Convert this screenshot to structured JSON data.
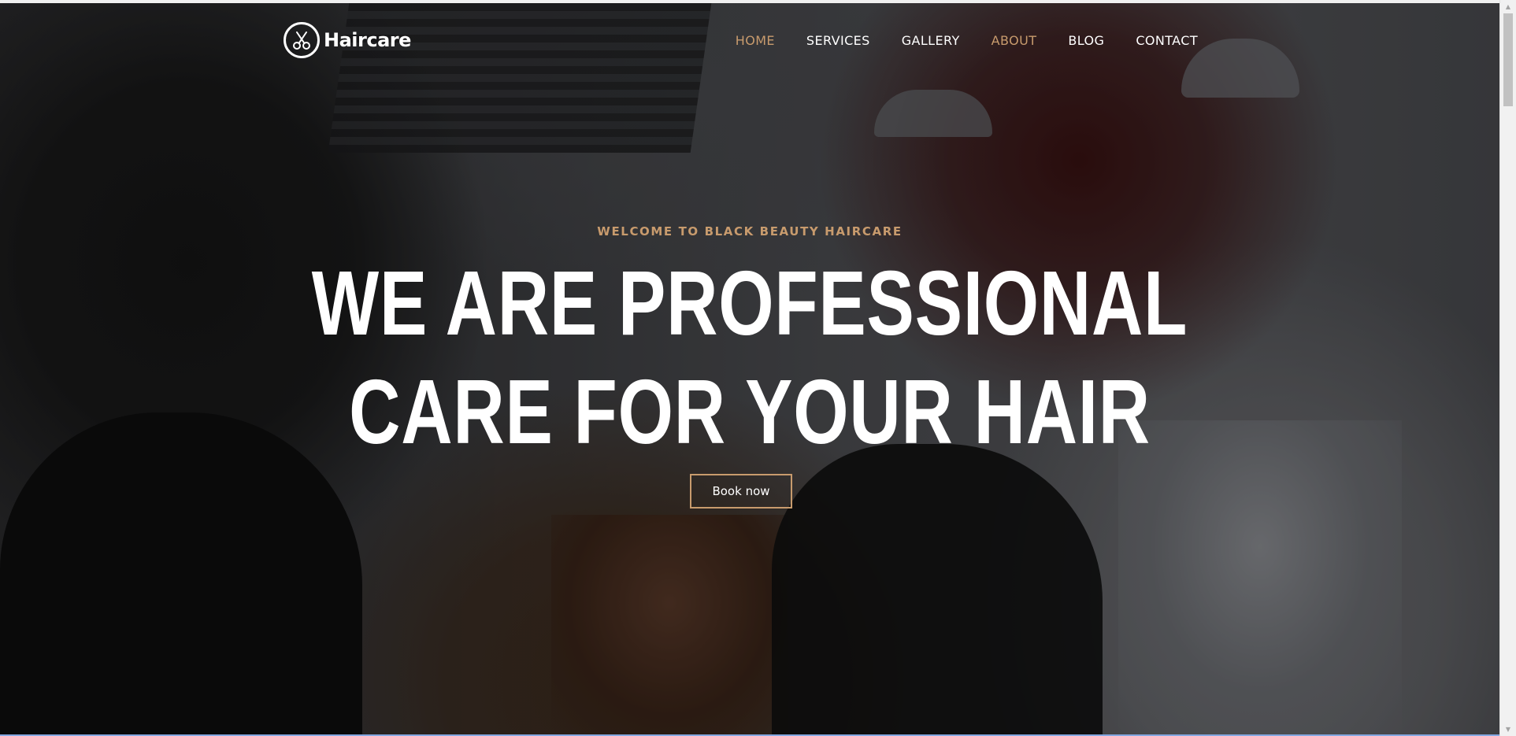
{
  "brand": {
    "name": "Haircare",
    "icon": "scissors-icon"
  },
  "nav": {
    "items": [
      {
        "label": "HOME",
        "active": true
      },
      {
        "label": "SERVICES",
        "active": false
      },
      {
        "label": "GALLERY",
        "active": false
      },
      {
        "label": "ABOUT",
        "active": true
      },
      {
        "label": "BLOG",
        "active": false
      },
      {
        "label": "CONTACT",
        "active": false
      }
    ]
  },
  "hero": {
    "subtitle": "WELCOME TO BLACK BEAUTY HAIRCARE",
    "headline_line1": "WE ARE PROFESSIONAL",
    "headline_line2": "CARE FOR YOUR HAIR",
    "cta_label": "Book now"
  },
  "colors": {
    "accent": "#c89b6d",
    "text": "#ffffff"
  }
}
